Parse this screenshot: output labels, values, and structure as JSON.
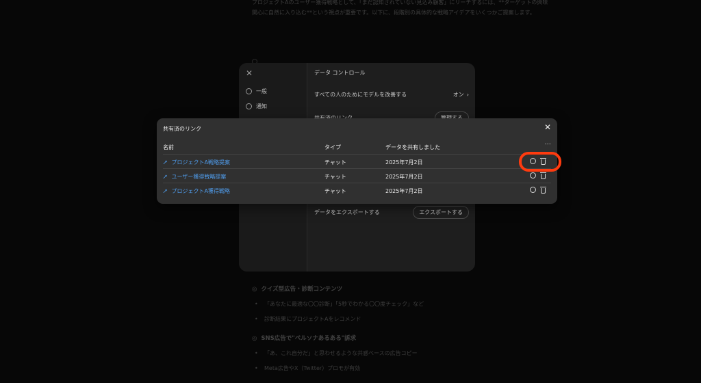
{
  "background": {
    "intro_text": "プロジェクトAのユーザー獲得戦略として、「まだ認知されていない見込み顧客」にリーチするには、**ターゲットの興味関心に自然に入り込む**という視点が重要です。以下に、段階別の具体的な戦略アイデアをいくつかご提案します。",
    "section1": {
      "heading": "クイズ型広告・診断コンテンツ",
      "bullets": [
        "「あなたに最適な〇〇診断」「5秒でわかる〇〇度チェック」など",
        "診断結果にプロジェクトAをレコメンド"
      ]
    },
    "section2": {
      "heading": "SNS広告で\"ペルソナあるある\"訴求",
      "bullets": [
        "「あ、これ自分だ」と思わせるような共感ベースの広告コピー",
        "Meta広告やX（Twitter）プロモが有効"
      ]
    }
  },
  "settings": {
    "close_glyph": "✕",
    "sidebar": [
      {
        "label": "一般",
        "icon": "gear-icon"
      },
      {
        "label": "通知",
        "icon": "bell-icon"
      }
    ],
    "title": "データ コントロール",
    "rows": {
      "improve_model": {
        "label": "すべての人のためにモデルを改善する",
        "value": "オン"
      },
      "shared_links": {
        "label": "共有済のリンク",
        "button": "管理する"
      },
      "export": {
        "label": "データをエクスポートする",
        "button": "エクスポートする"
      }
    }
  },
  "shared_links": {
    "title": "共有済のリンク",
    "close_glyph": "✕",
    "more_glyph": "···",
    "columns": {
      "name": "名前",
      "type": "タイプ",
      "date": "データを共有しました"
    },
    "rows": [
      {
        "name": "プロジェクトA戦略提案",
        "type": "チャット",
        "date": "2025年7月2日"
      },
      {
        "name": "ユーザー獲得戦略提案",
        "type": "チャット",
        "date": "2025年7月2日"
      },
      {
        "name": "プロジェクトA獲得戦略",
        "type": "チャット",
        "date": "2025年7月2日"
      }
    ]
  },
  "colors": {
    "link": "#4f9bea",
    "highlight": "#ff3b0f",
    "modal_bg": "#303030"
  }
}
